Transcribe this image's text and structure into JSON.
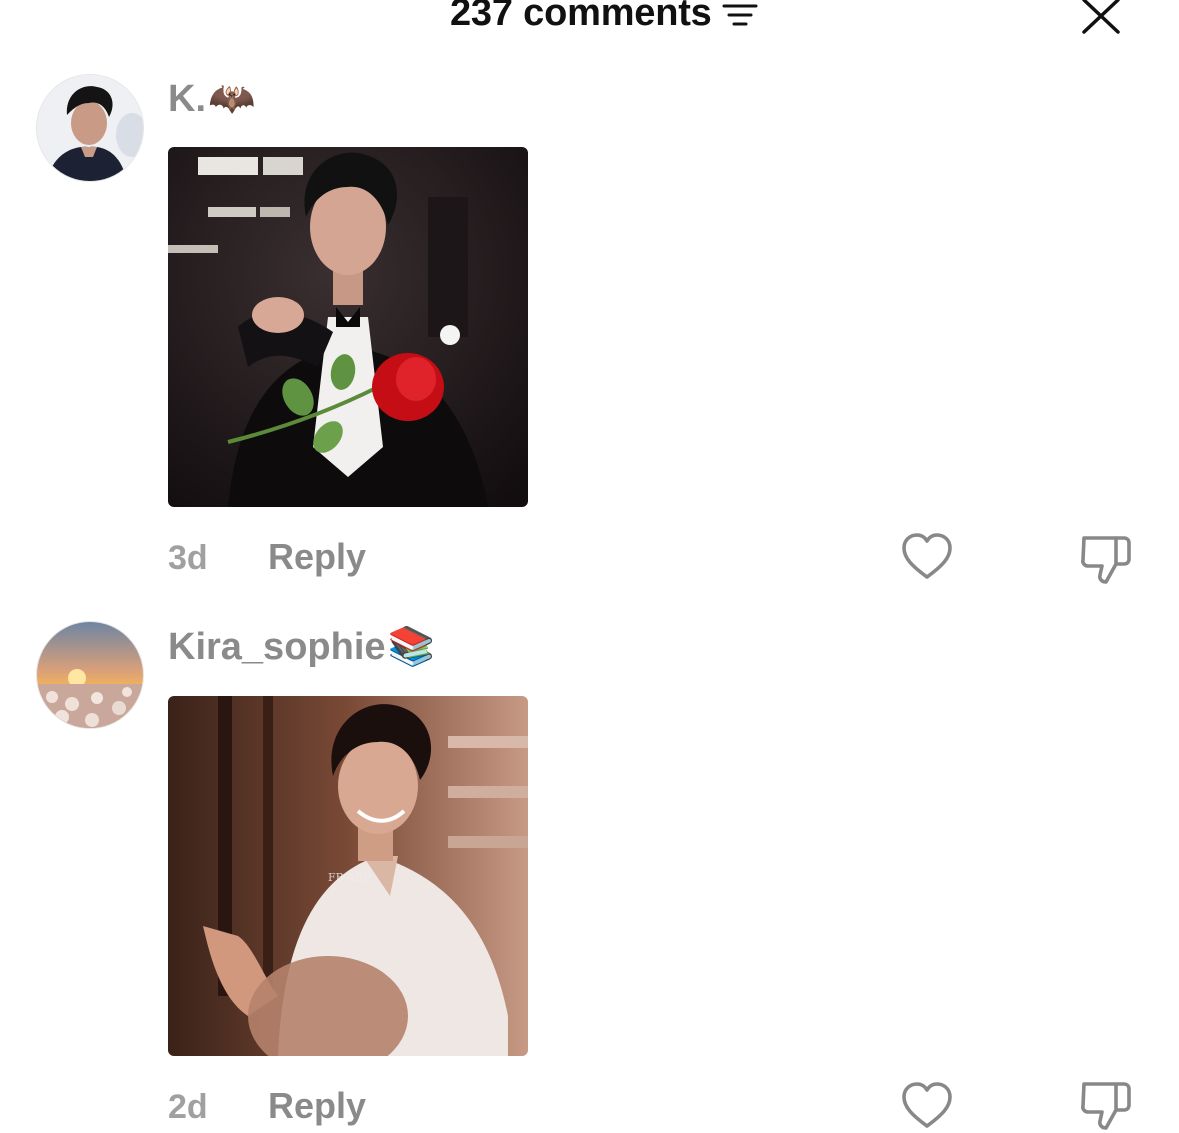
{
  "header": {
    "title": "237 comments",
    "sort_icon": "sort-filter-icon",
    "close_icon": "close-icon"
  },
  "comments": [
    {
      "username": "K.",
      "username_emoji": "🦇",
      "avatar_icon": "avatar-photo",
      "media": "photo-man-in-tuxedo-offering-rose",
      "time": "3d",
      "reply_label": "Reply",
      "like_icon": "heart-icon",
      "dislike_icon": "thumbs-down-icon"
    },
    {
      "username": "Kira_sophie",
      "username_emoji": "📚",
      "avatar_icon": "avatar-sunset-field",
      "media": "photo-smiling-man-in-white-tshirt",
      "watermark": "FB.AEP",
      "time": "2d",
      "reply_label": "Reply",
      "like_icon": "heart-icon",
      "dislike_icon": "thumbs-down-icon"
    }
  ],
  "colors": {
    "title": "#111111",
    "username": "#8a8a8a",
    "meta": "#a0a0a0",
    "icon": "#888888"
  }
}
